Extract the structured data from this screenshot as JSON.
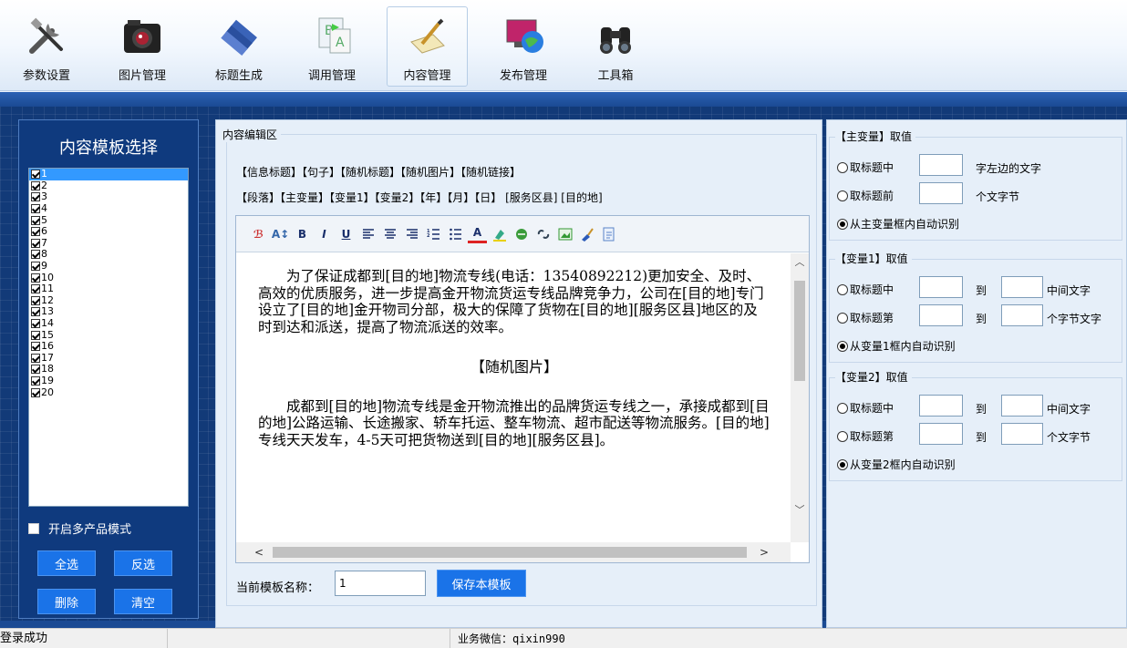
{
  "toolbar": {
    "items": [
      {
        "label": "参数设置",
        "icon": "tools-icon"
      },
      {
        "label": "图片管理",
        "icon": "camera-icon"
      },
      {
        "label": "标题生成",
        "icon": "books-icon"
      },
      {
        "label": "调用管理",
        "icon": "translate-icon"
      },
      {
        "label": "内容管理",
        "icon": "writing-icon",
        "active": true
      },
      {
        "label": "发布管理",
        "icon": "monitor-globe-icon"
      },
      {
        "label": "工具箱",
        "icon": "binoculars-icon"
      }
    ]
  },
  "left": {
    "title": "内容模板选择",
    "templates": [
      "1",
      "2",
      "3",
      "4",
      "5",
      "6",
      "7",
      "8",
      "9",
      "10",
      "11",
      "12",
      "13",
      "14",
      "15",
      "16",
      "17",
      "18",
      "19",
      "20"
    ],
    "selected_index": 0,
    "multi_product": "开启多产品模式",
    "buttons": {
      "select_all": "全选",
      "invert": "反选",
      "delete": "删除",
      "clear": "清空"
    }
  },
  "editor_area": {
    "group_label": "内容编辑区",
    "tags_line1": "【信息标题】【句子】【随机标题】【随机图片】【随机链接】",
    "tags_line2": "【段落】【主变量】【变量1】【变量2】【年】【月】【日】 [服务区县] [目的地]",
    "paragraph1": "为了保证成都到[目的地]物流专线(电话：13540892212)更加安全、及时、高效的优质服务，进一步提高金开物流货运专线品牌竞争力，公司在[目的地]专门设立了[目的地]金开物司分部，极大的保障了货物在[目的地][服务区县]地区的及时到达和派送，提高了物流派送的效率。",
    "random_image": "【随机图片】",
    "paragraph2": "成都到[目的地]物流专线是金开物流推出的品牌货运专线之一，承接成都到[目的地]公路运输、长途搬家、轿车托运、整车物流、超市配送等物流服务。[目的地]专线天天发车，4-5天可把货物送到[目的地][服务区县]。",
    "template_name_label": "当前模板名称：",
    "template_name_value": "1",
    "save_button": "保存本模板"
  },
  "right": {
    "main_var": {
      "title": "【主变量】取值",
      "opt1_prefix": "取标题中",
      "opt1_suffix": "字左边的文字",
      "opt2_prefix": "取标题前",
      "opt2_suffix": "个文字节",
      "opt3": "从主变量框内自动识别"
    },
    "var1": {
      "title": "【变量1】取值",
      "opt1_prefix": "取标题中",
      "to": "到",
      "opt1_suffix": "中间文字",
      "opt2_prefix": "取标题第",
      "opt2_suffix": "个字节文字",
      "opt3": "从变量1框内自动识别"
    },
    "var2": {
      "title": "【变量2】取值",
      "opt1_prefix": "取标题中",
      "to": "到",
      "opt1_suffix": "中间文字",
      "opt2_prefix": "取标题第",
      "opt2_suffix": "个文字节",
      "opt3": "从变量2框内自动识别"
    }
  },
  "status": {
    "left": "登录成功",
    "middle": "",
    "right": "业务微信：qixin990"
  },
  "colors": {
    "accent_button": "#1a73e8",
    "panel_dark": "#0f3a7e",
    "selected": "#3399ff"
  }
}
